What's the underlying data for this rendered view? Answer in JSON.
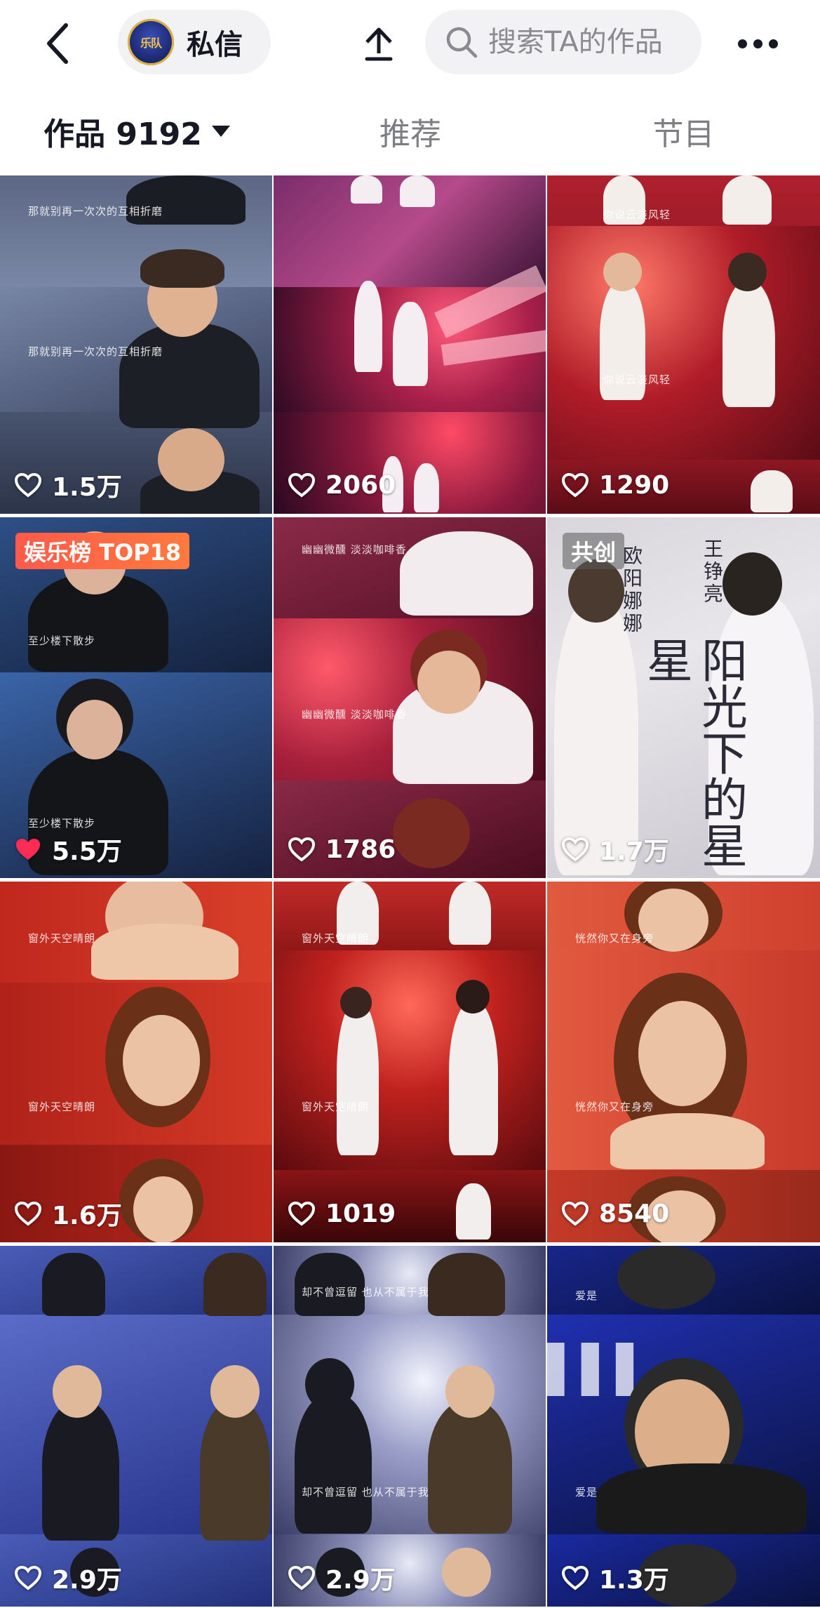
{
  "header": {
    "dm_label": "私信",
    "avatar_text": "乐队",
    "search_placeholder": "搜索TA的作品"
  },
  "tabs": [
    {
      "label": "作品 9192"
    },
    {
      "label": "推荐"
    },
    {
      "label": "节目"
    }
  ],
  "videos": [
    {
      "likes": "1.5万",
      "subtitle": "那就别再一次次的互相折磨"
    },
    {
      "likes": "2060"
    },
    {
      "likes": "1290",
      "subtitle": "你说云淡风轻"
    },
    {
      "likes": "5.5万",
      "badge": "娱乐榜 TOP18",
      "subtitle": "至少楼下散步",
      "liked": true
    },
    {
      "likes": "1786",
      "subtitle": "幽幽微醺 淡淡咖啡香"
    },
    {
      "likes": "1.7万",
      "badge": "共创",
      "poster_title": "阳光下的星星",
      "poster_names": [
        "欧阳娜娜",
        "王铮亮"
      ]
    },
    {
      "likes": "1.6万",
      "subtitle": "窗外天空晴朗"
    },
    {
      "likes": "1019",
      "subtitle": "窗外天空晴朗"
    },
    {
      "likes": "8540",
      "subtitle": "恍然你又在身旁"
    },
    {
      "likes": "2.9万"
    },
    {
      "likes": "2.9万",
      "subtitle": "却不曾逗留 也从不属于我"
    },
    {
      "likes": "1.3万",
      "subtitle": "爱是"
    }
  ],
  "colors": {
    "text_primary": "#161823",
    "text_secondary": "#7d7e84",
    "like_active": "#fe2c55",
    "badge_rank": "#ff6142"
  }
}
